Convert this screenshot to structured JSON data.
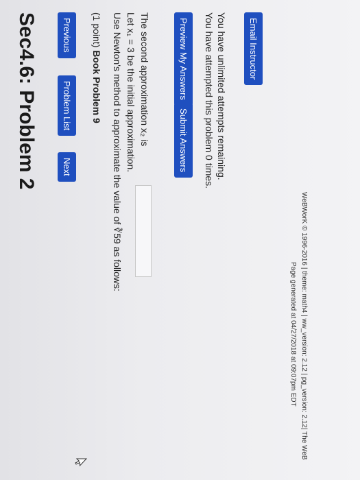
{
  "title": "Sec4.6: Problem 2",
  "nav": {
    "previous": "Previous",
    "problem_list": "Problem List",
    "next": "Next"
  },
  "problem": {
    "points": "(1 point)",
    "name": "Book Problem 9",
    "line1": "Use Newton's method to approximate the value of ∛59 as follows:",
    "line2": "Let x₁ = 3 be the initial approximation.",
    "line3": "The second approximation x₂ is",
    "answer_value": ""
  },
  "actions": {
    "preview": "Preview My Answers",
    "submit": "Submit Answers"
  },
  "status": {
    "attempted": "You have attempted this problem 0 times.",
    "remaining": "You have unlimited attempts remaining."
  },
  "email_label": "Email Instructor",
  "footer": {
    "generated": "Page generated at 04/27/2018 at 09:07pm EDT",
    "credit": "WeBWorK © 1996-2016 | theme: math4 | ww_version: 2.12 | pg_version: 2.12| The WeB"
  },
  "colors": {
    "button_bg": "#1f4fbf",
    "button_text": "#ffffff"
  },
  "icons": {
    "cursor": "arrow-cursor-icon"
  }
}
